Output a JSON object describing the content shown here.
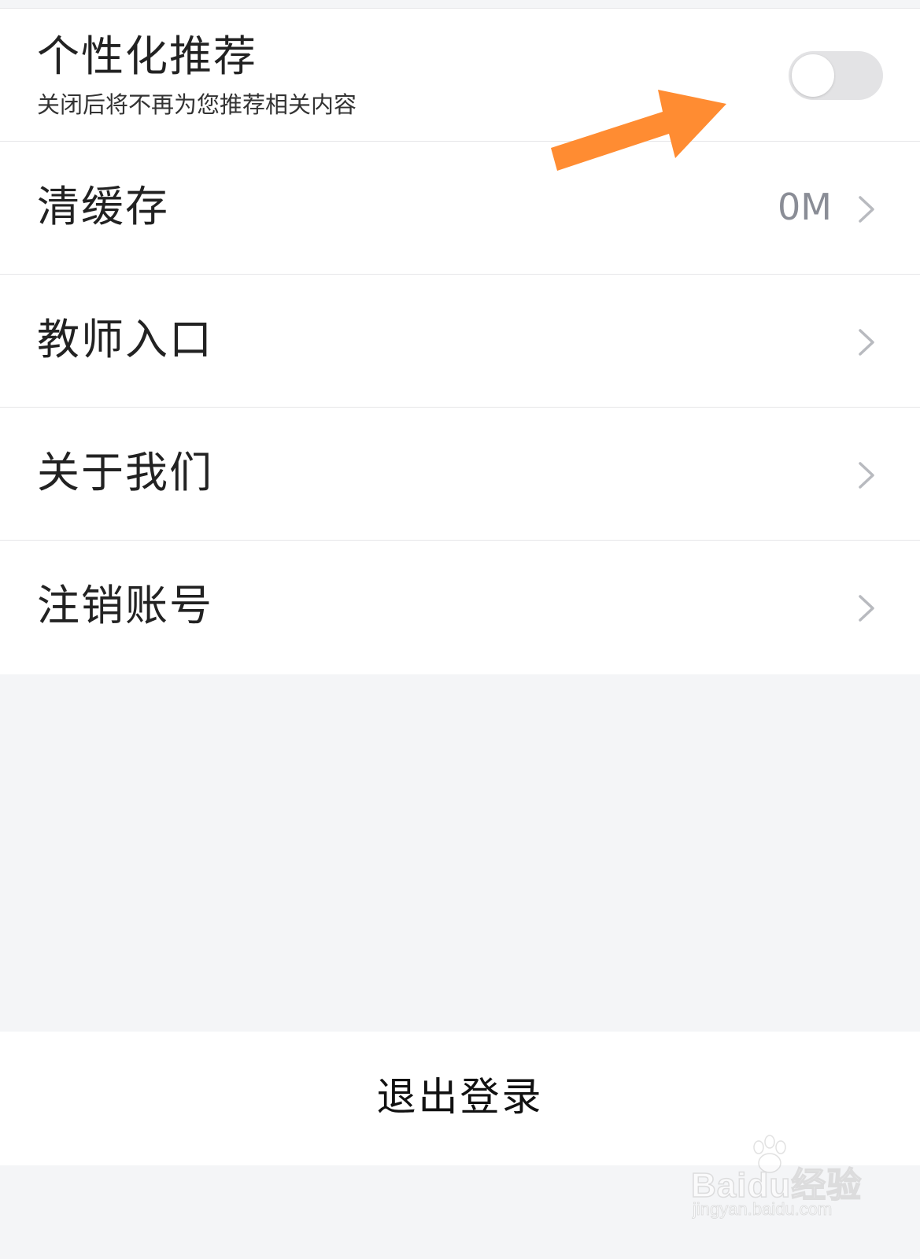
{
  "colors": {
    "page_background": "#f4f5f7",
    "card_background": "#ffffff",
    "divider": "#e6e6e8",
    "title_text": "#222222",
    "value_text": "#8a8d96",
    "chevron": "#b8babf",
    "toggle_off_track": "#e3e3e5",
    "annotation_arrow": "#ff8c32"
  },
  "settings": {
    "personalized": {
      "title": "个性化推荐",
      "subtitle": "关闭后将不再为您推荐相关内容",
      "toggle_on": false
    },
    "clear_cache": {
      "title": "清缓存",
      "value": "0M"
    },
    "teacher_entry": {
      "title": "教师入口"
    },
    "about_us": {
      "title": "关于我们"
    },
    "delete_account": {
      "title": "注销账号"
    }
  },
  "logout": {
    "label": "退出登录"
  },
  "watermark": {
    "brand": "Baidu经验",
    "url": "jingyan.baidu.com"
  },
  "icons": {
    "row_chevron": "chevron-right-icon",
    "annotation": "orange-arrow-annotation",
    "watermark_logo": "baidu-paw-logo"
  }
}
